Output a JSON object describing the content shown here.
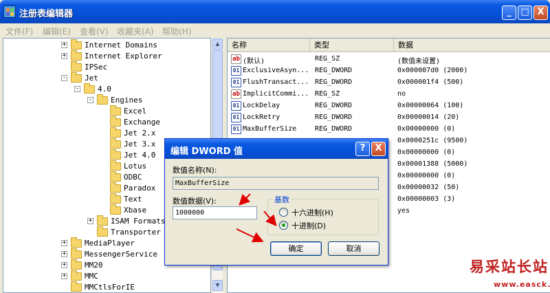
{
  "window": {
    "title": "注册表编辑器",
    "minimize": "_",
    "maximize": "□",
    "close": "X"
  },
  "menu": [
    "文件(F)",
    "编辑(E)",
    "查看(V)",
    "收藏夹(A)",
    "帮助(H)"
  ],
  "tree": [
    {
      "label": "Internet Domains",
      "level": 0,
      "expander": "+"
    },
    {
      "label": "Internet Explorer",
      "level": 0,
      "expander": "+"
    },
    {
      "label": "IPSec",
      "level": 0,
      "expander": ""
    },
    {
      "label": "Jet",
      "level": 0,
      "expander": "-"
    },
    {
      "label": "4.0",
      "level": 1,
      "expander": "-"
    },
    {
      "label": "Engines",
      "level": 2,
      "expander": "-"
    },
    {
      "label": "Excel",
      "level": 3,
      "expander": ""
    },
    {
      "label": "Exchange",
      "level": 3,
      "expander": ""
    },
    {
      "label": "Jet 2.x",
      "level": 3,
      "expander": ""
    },
    {
      "label": "Jet 3.x",
      "level": 3,
      "expander": ""
    },
    {
      "label": "Jet 4.0",
      "level": 3,
      "expander": ""
    },
    {
      "label": "Lotus",
      "level": 3,
      "expander": ""
    },
    {
      "label": "ODBC",
      "level": 3,
      "expander": ""
    },
    {
      "label": "Paradox",
      "level": 3,
      "expander": ""
    },
    {
      "label": "Text",
      "level": 3,
      "expander": ""
    },
    {
      "label": "Xbase",
      "level": 3,
      "expander": ""
    },
    {
      "label": "ISAM Formats",
      "level": 2,
      "expander": "+"
    },
    {
      "label": "Transporter",
      "level": 2,
      "expander": ""
    },
    {
      "label": "MediaPlayer",
      "level": 0,
      "expander": "+"
    },
    {
      "label": "MessengerService",
      "level": 0,
      "expander": "+"
    },
    {
      "label": "MM20",
      "level": 0,
      "expander": "+"
    },
    {
      "label": "MMC",
      "level": 0,
      "expander": "+"
    },
    {
      "label": "MMCtlsForIE",
      "level": 0,
      "expander": ""
    }
  ],
  "list": {
    "columns": [
      "名称",
      "类型",
      "数据"
    ],
    "rows": [
      {
        "icon": "ab",
        "name": "(默认)",
        "type": "REG_SZ",
        "data": "(数值未设置)"
      },
      {
        "icon": "01",
        "name": "ExclusiveAsyn...",
        "type": "REG_DWORD",
        "data": "0x000007d0 (2000)"
      },
      {
        "icon": "01",
        "name": "FlushTransact...",
        "type": "REG_DWORD",
        "data": "0x000001f4 (500)"
      },
      {
        "icon": "ab",
        "name": "ImplicitCommi...",
        "type": "REG_SZ",
        "data": "no"
      },
      {
        "icon": "01",
        "name": "LockDelay",
        "type": "REG_DWORD",
        "data": "0x00000064 (100)"
      },
      {
        "icon": "01",
        "name": "LockRetry",
        "type": "REG_DWORD",
        "data": "0x00000014 (20)"
      },
      {
        "icon": "01",
        "name": "MaxBufferSize",
        "type": "REG_DWORD",
        "data": "0x00000000 (0)"
      },
      {
        "icon": "",
        "name": "",
        "type": "",
        "data": "0x0000251c (9500)"
      },
      {
        "icon": "",
        "name": "",
        "type": "",
        "data": "0x00000000 (0)"
      },
      {
        "icon": "",
        "name": "",
        "type": "",
        "data": "0x00001388 (5000)"
      },
      {
        "icon": "",
        "name": "",
        "type": "",
        "data": "0x00000000 (0)"
      },
      {
        "icon": "",
        "name": "",
        "type": "",
        "data": "0x00000032 (50)"
      },
      {
        "icon": "",
        "name": "",
        "type": "",
        "data": "0x00000003 (3)"
      },
      {
        "icon": "",
        "name": "",
        "type": "",
        "data": "yes"
      }
    ]
  },
  "dialog": {
    "title": "编辑 DWORD 值",
    "help": "?",
    "close": "X",
    "name_label": "数值名称(N):",
    "name_value": "MaxBufferSize",
    "data_label": "数值数据(V):",
    "data_value": "1000000",
    "base_legend": "基数",
    "radio_hex": "十六进制(H)",
    "radio_dec": "十进制(D)",
    "selected_base": "decimal",
    "ok": "确定",
    "cancel": "取消"
  },
  "annotation_color": "#e00000",
  "watermark": {
    "text": "易采站长站",
    "url": "www.easck.com"
  }
}
